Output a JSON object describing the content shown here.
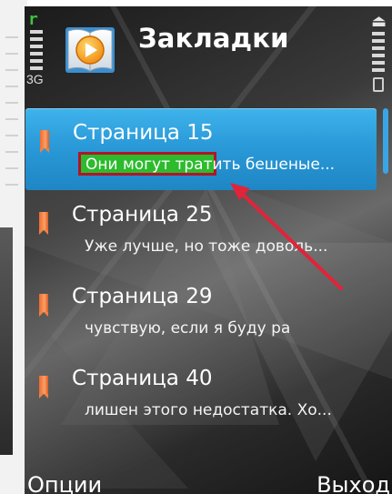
{
  "status": {
    "network_type": "3G",
    "signal_glyph": "r"
  },
  "header": {
    "title": "Закладки",
    "icon": "book-play-icon"
  },
  "bookmarks": [
    {
      "title": "Страница 15",
      "snippet": "Они могут тратить бешеные...",
      "selected": true
    },
    {
      "title": "Страница 25",
      "snippet": "Уже лучше, но тоже доволь...",
      "selected": false
    },
    {
      "title": "Страница 29",
      "snippet": "чувствую, если я буду ра",
      "selected": false
    },
    {
      "title": "Страница 40",
      "snippet": "лишен этого недостатка. Хо...",
      "selected": false
    }
  ],
  "softkeys": {
    "left": "Опции",
    "right": "Выход"
  },
  "colors": {
    "selection": "#2a9ad8",
    "bookmark_icon": "#f26a2c",
    "highlight": "#2dbb2d",
    "annotation": "#e0243a"
  }
}
